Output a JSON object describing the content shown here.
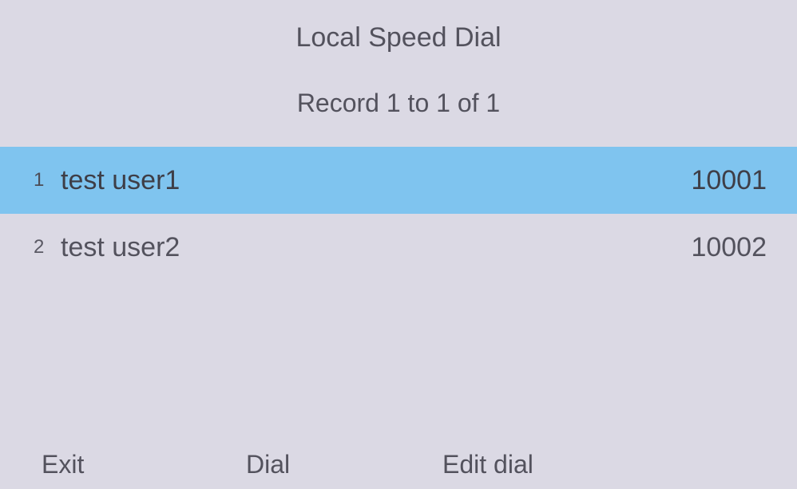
{
  "header": {
    "title": "Local Speed Dial",
    "record_info": "Record 1 to 1 of 1"
  },
  "entries": [
    {
      "index": "1",
      "name": "test user1",
      "number": "10001",
      "selected": true
    },
    {
      "index": "2",
      "name": "test user2",
      "number": "10002",
      "selected": false
    }
  ],
  "softkeys": {
    "sk1": "Exit",
    "sk2": "Dial",
    "sk3": "Edit dial",
    "sk4": ""
  }
}
